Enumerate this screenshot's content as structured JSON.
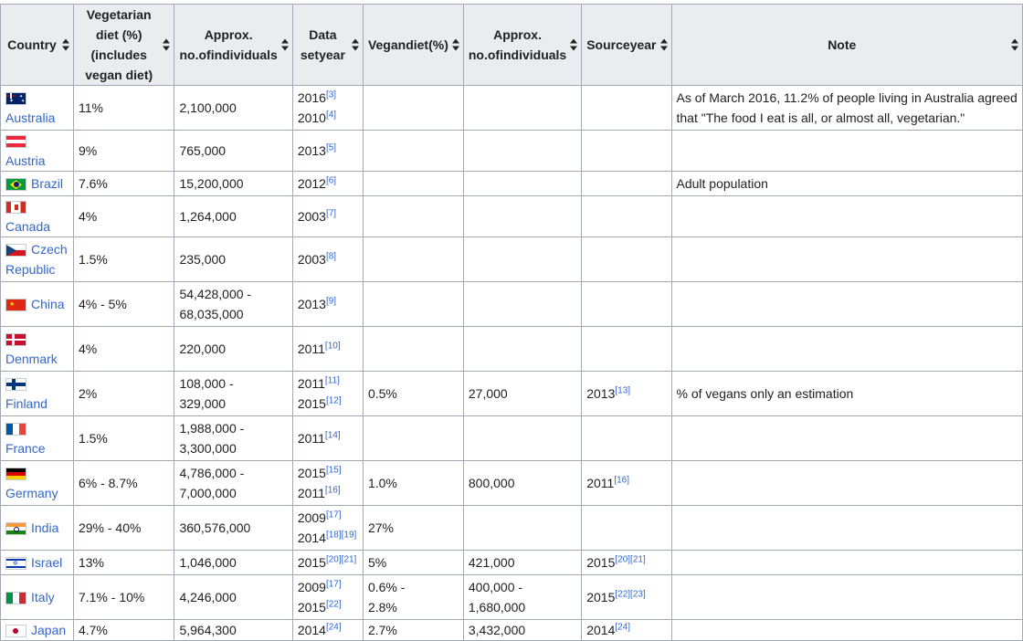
{
  "columns": [
    {
      "label_lines": [
        "Country"
      ]
    },
    {
      "label_lines": [
        "Vegetarian diet (%)",
        "(includes vegan diet)"
      ]
    },
    {
      "label_lines": [
        "Approx. no.",
        "of",
        "individuals"
      ]
    },
    {
      "label_lines": [
        "Data set",
        "year"
      ]
    },
    {
      "label_lines": [
        "Vegan",
        "diet",
        "(%)"
      ]
    },
    {
      "label_lines": [
        "Approx. no.",
        "of",
        "individuals"
      ]
    },
    {
      "label_lines": [
        "Source",
        "year"
      ]
    },
    {
      "label_lines": [
        "Note"
      ]
    }
  ],
  "rows": [
    {
      "country": "Australia",
      "flag": "australia",
      "veg": "11%",
      "approx": [
        "2,100,000"
      ],
      "years": [
        {
          "y": "2016",
          "ref": "[3]"
        },
        {
          "y": "2010",
          "ref": "[4]"
        }
      ],
      "vegan": [],
      "vegan_approx": [],
      "source": [],
      "note": [
        "As of March 2016, 11.2% of people living in Australia agreed",
        "that \"The food I eat is all, or almost all, vegetarian.\""
      ]
    },
    {
      "country": "Austria",
      "flag": "austria",
      "veg": "9%",
      "approx": [
        "765,000"
      ],
      "years": [
        {
          "y": "2013",
          "ref": "[5]"
        }
      ],
      "vegan": [],
      "vegan_approx": [],
      "source": [],
      "note": []
    },
    {
      "country": "Brazil",
      "flag": "brazil",
      "veg": "7.6%",
      "approx": [
        "15,200,000"
      ],
      "years": [
        {
          "y": "2012",
          "ref": "[6]"
        }
      ],
      "vegan": [],
      "vegan_approx": [],
      "source": [],
      "note": [
        "Adult population"
      ]
    },
    {
      "country": "Canada",
      "flag": "canada",
      "veg": "4%",
      "approx": [
        "1,264,000"
      ],
      "years": [
        {
          "y": "2003",
          "ref": "[7]"
        }
      ],
      "vegan": [],
      "vegan_approx": [],
      "source": [],
      "note": []
    },
    {
      "country": "Czech Republic",
      "flag": "czech",
      "veg": "1.5%",
      "approx": [
        "235,000"
      ],
      "years": [
        {
          "y": "2003",
          "ref": "[8]"
        }
      ],
      "vegan": [],
      "vegan_approx": [],
      "source": [],
      "note": []
    },
    {
      "country": "China",
      "flag": "china",
      "veg": "4% - 5%",
      "approx": [
        "54,428,000 -",
        "68,035,000"
      ],
      "years": [
        {
          "y": "2013",
          "ref": "[9]"
        }
      ],
      "vegan": [],
      "vegan_approx": [],
      "source": [],
      "note": []
    },
    {
      "country": "Denmark",
      "flag": "denmark",
      "veg": "4%",
      "approx": [
        "220,000"
      ],
      "years": [
        {
          "y": "2011",
          "ref": "[10]"
        }
      ],
      "vegan": [],
      "vegan_approx": [],
      "source": [],
      "note": []
    },
    {
      "country": "Finland",
      "flag": "finland",
      "veg": "2%",
      "approx": [
        "108,000 -",
        "329,000"
      ],
      "years": [
        {
          "y": "2011",
          "ref": "[11]"
        },
        {
          "y": "2015",
          "ref": "[12]"
        }
      ],
      "vegan": [
        "0.5%"
      ],
      "vegan_approx": [
        "27,000"
      ],
      "source": [
        {
          "y": "2013",
          "ref": "[13]"
        }
      ],
      "note": [
        "% of vegans only an estimation"
      ]
    },
    {
      "country": "France",
      "flag": "france",
      "veg": "1.5%",
      "approx": [
        "1,988,000 -",
        "3,300,000"
      ],
      "years": [
        {
          "y": "2011",
          "ref": "[14]"
        }
      ],
      "vegan": [],
      "vegan_approx": [],
      "source": [],
      "note": []
    },
    {
      "country": "Germany",
      "flag": "germany",
      "veg": "6% - 8.7%",
      "approx": [
        "4,786,000 -",
        "7,000,000"
      ],
      "years": [
        {
          "y": "2015",
          "ref": "[15]"
        },
        {
          "y": "2011",
          "ref": "[16]"
        }
      ],
      "vegan": [
        "1.0%"
      ],
      "vegan_approx": [
        "800,000"
      ],
      "source": [
        {
          "y": "2011",
          "ref": "[16]"
        }
      ],
      "note": []
    },
    {
      "country": "India",
      "flag": "india",
      "veg": "29% - 40%",
      "approx": [
        "360,576,000"
      ],
      "years": [
        {
          "y": "2009",
          "ref": "[17]"
        },
        {
          "y": "2014",
          "ref": "[18][19]"
        }
      ],
      "vegan": [
        "27%"
      ],
      "vegan_approx": [],
      "source": [],
      "note": []
    },
    {
      "country": "Israel",
      "flag": "israel",
      "veg": "13%",
      "approx": [
        "1,046,000"
      ],
      "years": [
        {
          "y": "2015",
          "ref": "[20][21]"
        }
      ],
      "vegan": [
        "5%"
      ],
      "vegan_approx": [
        "421,000"
      ],
      "source": [
        {
          "y": "2015",
          "ref": "[20][21]"
        }
      ],
      "note": []
    },
    {
      "country": "Italy",
      "flag": "italy",
      "veg": "7.1% - 10%",
      "approx": [
        "4,246,000"
      ],
      "years": [
        {
          "y": "2009",
          "ref": "[17]"
        },
        {
          "y": "2015",
          "ref": "[22]"
        }
      ],
      "vegan": [
        "0.6% -",
        "2.8%"
      ],
      "vegan_approx": [
        "400,000 -",
        "1,680,000"
      ],
      "source": [
        {
          "y": "2015",
          "ref": "[22][23]"
        }
      ],
      "note": []
    },
    {
      "country": "Japan",
      "flag": "japan",
      "veg": "4.7%",
      "approx": [
        "5,964,300"
      ],
      "years": [
        {
          "y": "2014",
          "ref": "[24]"
        }
      ],
      "vegan": [
        "2.7%"
      ],
      "vegan_approx": [
        "3,432,000"
      ],
      "source": [
        {
          "y": "2014",
          "ref": "[24]"
        }
      ],
      "note": []
    }
  ]
}
